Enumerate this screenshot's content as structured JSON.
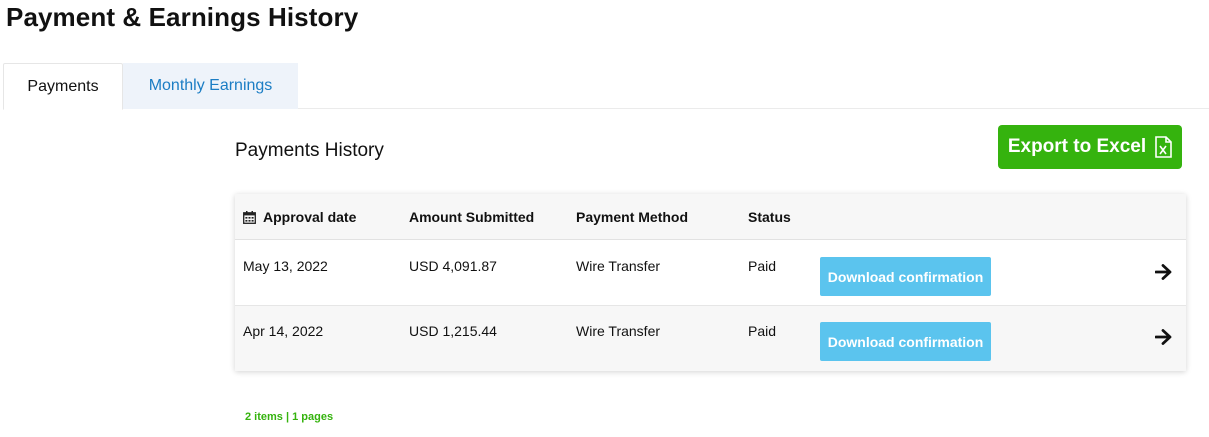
{
  "page": {
    "title": "Payment & Earnings History"
  },
  "tabs": [
    {
      "label": "Payments",
      "active": true
    },
    {
      "label": "Monthly Earnings",
      "active": false
    }
  ],
  "section": {
    "title": "Payments History"
  },
  "export": {
    "label": "Export to Excel",
    "icon": "excel-file-icon",
    "color": "#35b30e"
  },
  "table": {
    "headers": [
      "Approval date",
      "Amount Submitted",
      "Payment Method",
      "Status"
    ],
    "header_icon": "calendar-icon",
    "rows": [
      {
        "date": "May 13, 2022",
        "amount": "USD 4,091.87",
        "method": "Wire Transfer",
        "status": "Paid",
        "action": "Download confirmation"
      },
      {
        "date": "Apr 14, 2022",
        "amount": "USD 1,215.44",
        "method": "Wire Transfer",
        "status": "Paid",
        "action": "Download confirmation"
      }
    ],
    "row_arrow_icon": "arrow-right-icon",
    "action_color": "#5bc4ee"
  },
  "pagination": {
    "summary": "2 items | 1 pages"
  }
}
